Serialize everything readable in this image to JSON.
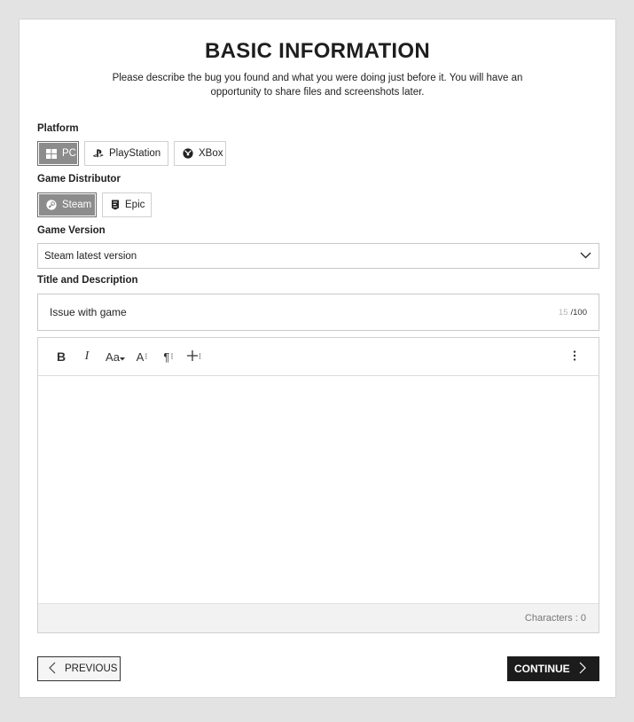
{
  "header": {
    "title": "BASIC INFORMATION",
    "subtitle": "Please describe the bug you found and what you were doing just before it. You will have an opportunity to share files and screenshots later."
  },
  "platform": {
    "label": "Platform",
    "options": [
      {
        "label": "PC",
        "icon": "windows-icon",
        "selected": true
      },
      {
        "label": "PlayStation",
        "icon": "playstation-icon",
        "selected": false
      },
      {
        "label": "XBox",
        "icon": "xbox-icon",
        "selected": false
      }
    ]
  },
  "distributor": {
    "label": "Game Distributor",
    "options": [
      {
        "label": "Steam",
        "icon": "steam-icon",
        "selected": true
      },
      {
        "label": "Epic",
        "icon": "epic-icon",
        "selected": false
      }
    ]
  },
  "version": {
    "label": "Game Version",
    "value": "Steam latest version",
    "icon": "chevron-down-icon"
  },
  "description": {
    "label": "Title and Description",
    "title_value": "Issue with game",
    "count_current": "15",
    "count_max": "/100",
    "toolbar": {
      "bold": "B",
      "italic": "I",
      "font_size": "Aa",
      "text_style": "A",
      "paragraph": "¶"
    },
    "characters": "Characters : 0"
  },
  "nav": {
    "previous": "PREVIOUS",
    "continue": "CONTINUE"
  },
  "colors": {
    "selected_bg": "#8c8c8c",
    "primary_button": "#1c1c1c",
    "page_bg": "#e3e3e3"
  }
}
